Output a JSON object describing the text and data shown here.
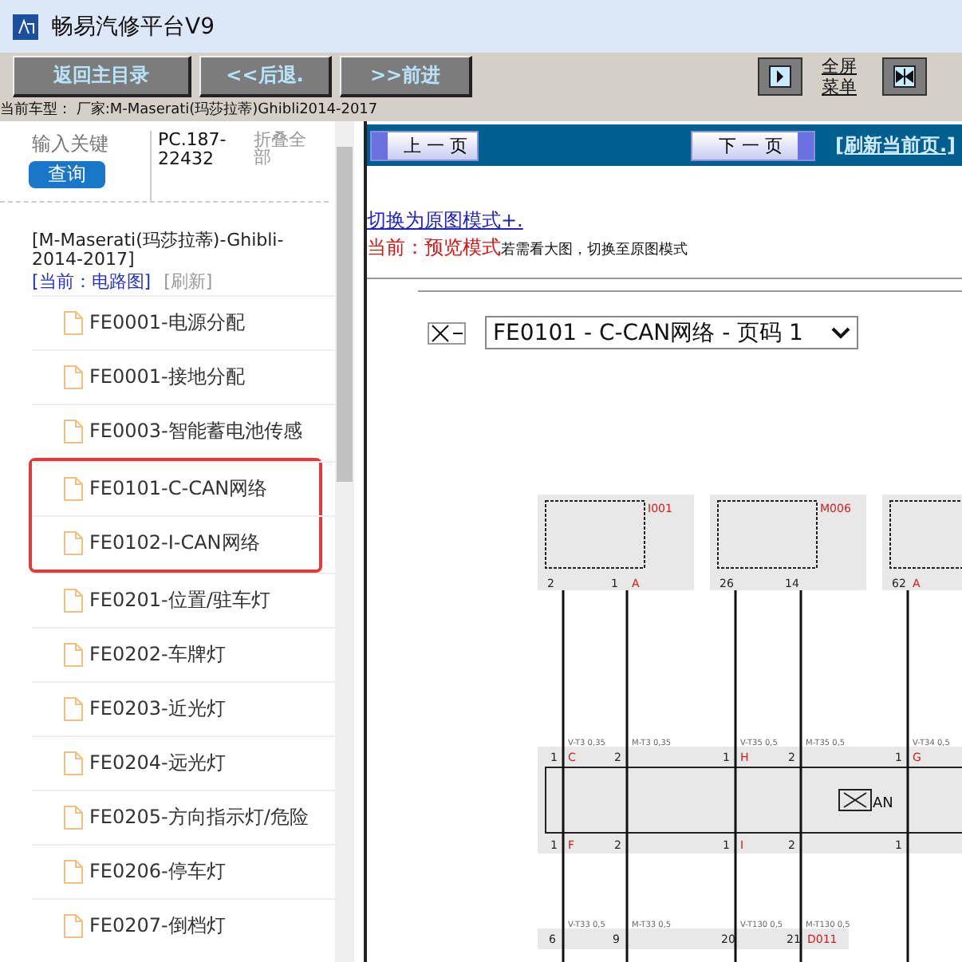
{
  "window": {
    "title": "畅易汽修平台V9"
  },
  "toolbar": {
    "buttons": [
      "返回主目录",
      "<<后退.",
      ">>前进"
    ],
    "fullscreen_label": "全屏菜单"
  },
  "current_model": "当前车型： 厂家:M-Maserati(玛莎拉蒂)Ghibli2014-2017",
  "sidebar": {
    "search": {
      "placeholder": "输入关键"
    },
    "query_button": "查询",
    "code": "PC.187-22432",
    "collapse_all": "折叠全部",
    "model": "[M-Maserati(玛莎拉蒂)-Ghibli-2014-2017]",
    "current": "[当前：电路图]",
    "refresh": "[刷新]",
    "items": [
      {
        "label": "FE0001-电源分配",
        "highlighted": false
      },
      {
        "label": "FE0001-接地分配",
        "highlighted": false
      },
      {
        "label": "FE0003-智能蓄电池传感",
        "highlighted": false
      },
      {
        "label": "FE0101-C-CAN网络",
        "highlighted": true
      },
      {
        "label": "FE0102-I-CAN网络",
        "highlighted": true
      },
      {
        "label": "FE0201-位置/驻车灯",
        "highlighted": false
      },
      {
        "label": "FE0202-车牌灯",
        "highlighted": false
      },
      {
        "label": "FE0203-近光灯",
        "highlighted": false
      },
      {
        "label": "FE0204-远光灯",
        "highlighted": false
      },
      {
        "label": "FE0205-方向指示灯/危险",
        "highlighted": false
      },
      {
        "label": "FE0206-停车灯",
        "highlighted": false
      },
      {
        "label": "FE0207-倒档灯",
        "highlighted": false
      }
    ]
  },
  "viewer": {
    "prev_page": "上 一 页",
    "next_page": "下 一 页",
    "refresh_page": "[刷新当前页.]",
    "switch_link": "切换为原图模式+.",
    "mode_label": "当前：预览模式",
    "mode_hint": "若需看大图，切换至原图模式",
    "page_select": "FE0101 - C-CAN网络 - 页码 1",
    "diagram": {
      "modules": [
        {
          "label": "I001"
        },
        {
          "label": "M006"
        }
      ],
      "unit_label": "AN",
      "connector_label": "D011",
      "wires": [
        {
          "module_pin": "2",
          "upper_pin": "1",
          "upper_letter": "C",
          "upper_wire": "V-T3 0,35",
          "lower_pin": "1",
          "lower_letter": "F",
          "lower_wire": "V-T33 0,5",
          "end_pin": "6"
        },
        {
          "module_pin": "1",
          "module_letter": "A",
          "upper_pin": "2",
          "upper_wire": "M-T3 0,35",
          "lower_pin": "2",
          "lower_wire": "M-T33 0,5",
          "end_pin": "9"
        },
        {
          "module_pin": "26",
          "upper_pin": "1",
          "upper_letter": "H",
          "upper_wire": "V-T35 0,5",
          "lower_pin": "1",
          "lower_letter": "I",
          "lower_wire": "V-T130 0,5",
          "end_pin": "20"
        },
        {
          "module_pin": "14",
          "upper_pin": "2",
          "upper_wire": "M-T35 0,5",
          "lower_pin": "2",
          "lower_wire": "M-T130 0,5",
          "end_pin": "21"
        },
        {
          "module_pin": "62",
          "module_letter": "A",
          "upper_pin": "1",
          "upper_letter": "G",
          "upper_wire": "V-T34 0,5",
          "lower_pin": "1"
        }
      ]
    }
  }
}
